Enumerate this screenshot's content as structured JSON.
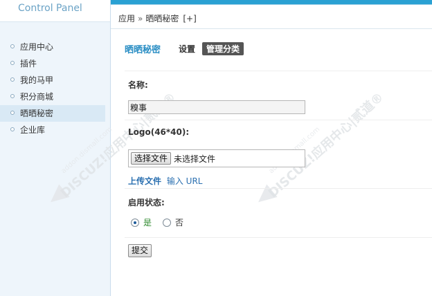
{
  "brand": "Control Panel",
  "sidebar": {
    "items": [
      {
        "label": "应用中心"
      },
      {
        "label": "插件"
      },
      {
        "label": "我的马甲"
      },
      {
        "label": "积分商城"
      },
      {
        "label": "晒晒秘密",
        "active": true
      },
      {
        "label": "企业库"
      }
    ]
  },
  "breadcrumb": {
    "root": "应用",
    "sep": "»",
    "current": "晒晒秘密",
    "add": "[+]"
  },
  "tabs": {
    "title": "晒晒秘密",
    "settings": "设置",
    "manage": "管理分类"
  },
  "form": {
    "name_label": "名称:",
    "name_value": "糗事",
    "logo_label": "Logo(46*40):",
    "file_button": "选择文件",
    "file_status": "未选择文件",
    "upload_link": "上传文件",
    "input_url_link": "输入 URL",
    "status_label": "启用状态:",
    "radio_yes": "是",
    "radio_no": "否",
    "radio_selected": "是",
    "submit": "提交"
  },
  "watermark": {
    "main": "DISCUZ!应用中心|贰道®",
    "sub": "addon.dismall.com"
  },
  "colors": {
    "accent": "#2aa1d3",
    "sidebar_bg": "#eef5fb",
    "link": "#2a6fb0",
    "tab_title": "#2a8ec4",
    "active_tab_bg": "#555555"
  }
}
